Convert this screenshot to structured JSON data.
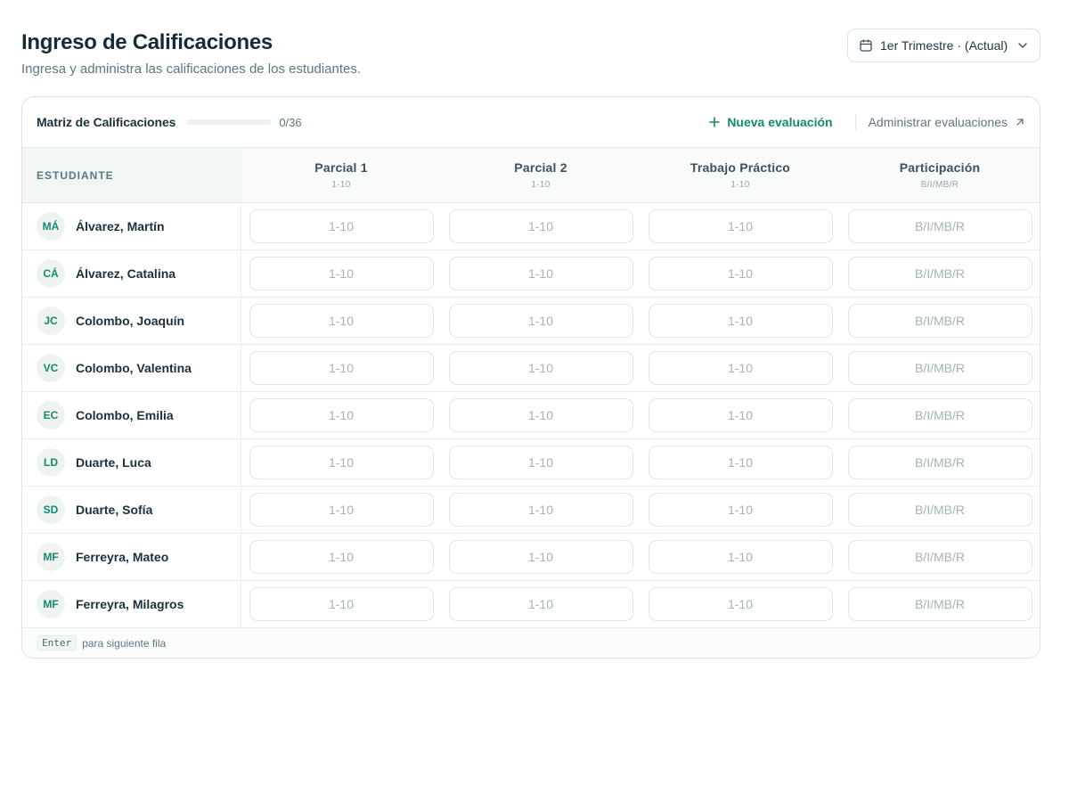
{
  "header": {
    "title": "Ingreso de Calificaciones",
    "subtitle": "Ingresa y administra las calificaciones de los estudiantes."
  },
  "term_selector": {
    "label": "1er Trimestre · (Actual)",
    "icon": "calendar-icon",
    "chevron_icon": "chevron-down-icon"
  },
  "toolbar": {
    "title": "Matriz de Calificaciones",
    "progress_text": "0/36",
    "progress_fraction": 0,
    "new_eval_label": "Nueva evaluación",
    "manage_label": "Administrar evaluaciones"
  },
  "table": {
    "student_header": "ESTUDIANTE",
    "columns": [
      {
        "name": "Parcial 1",
        "scale": "1-10",
        "placeholder": "1-10"
      },
      {
        "name": "Parcial 2",
        "scale": "1-10",
        "placeholder": "1-10"
      },
      {
        "name": "Trabajo Práctico",
        "scale": "1-10",
        "placeholder": "1-10"
      },
      {
        "name": "Participación",
        "scale": "B/I/MB/R",
        "placeholder": "B/I/MB/R"
      }
    ],
    "students": [
      {
        "initials": "MÁ",
        "name": "Álvarez, Martín"
      },
      {
        "initials": "CÁ",
        "name": "Álvarez, Catalina"
      },
      {
        "initials": "JC",
        "name": "Colombo, Joaquín"
      },
      {
        "initials": "VC",
        "name": "Colombo, Valentina"
      },
      {
        "initials": "EC",
        "name": "Colombo, Emilia"
      },
      {
        "initials": "LD",
        "name": "Duarte, Luca"
      },
      {
        "initials": "SD",
        "name": "Duarte, Sofía"
      },
      {
        "initials": "MF",
        "name": "Ferreyra, Mateo"
      },
      {
        "initials": "MF",
        "name": "Ferreyra, Milagros"
      }
    ]
  },
  "footer": {
    "key": "Enter",
    "text": "para siguiente fila"
  },
  "colors": {
    "accent": "#128a6e",
    "text": "#1a323c",
    "muted": "#5d7680",
    "border": "#dfe7e7"
  }
}
